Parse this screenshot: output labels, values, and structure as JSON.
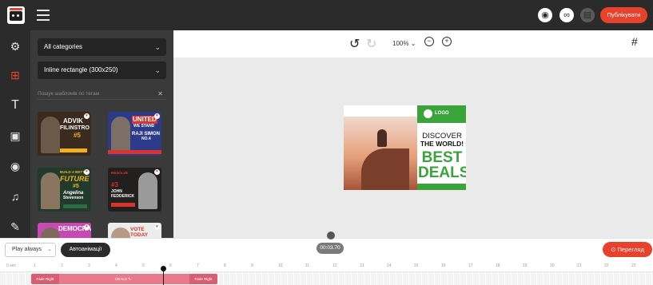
{
  "topbar": {
    "publish_label": "Публікувати"
  },
  "rail": {
    "items": [
      "settings-icon",
      "templates-icon",
      "text-icon",
      "image-icon",
      "video-icon",
      "music-icon",
      "brush-icon"
    ]
  },
  "panel": {
    "category_value": "All categories",
    "size_value": "Inline rectangle (300x250)",
    "search_placeholder": "Пошук шаблонів по тегам"
  },
  "templates": [
    {
      "line1": "ADVIK",
      "line2": "FILINSTRO",
      "line3": "#5"
    },
    {
      "line1": "UNITED",
      "line2": "WE STAND",
      "line3": "RAJI SIMON",
      "line4": "NO.4"
    },
    {
      "line1": "BUILD A BETTER",
      "line2": "FUTURE",
      "line3": "#5",
      "line4": "Angelina",
      "line5": "Stevenson"
    },
    {
      "line1": "RESOLVE",
      "line2": "#3",
      "line3": "JOHN",
      "line4": "FEDDERICK"
    },
    {
      "line1": "DEMOCRACY"
    },
    {
      "line1": "VOTE TODAY"
    }
  ],
  "toolbar": {
    "zoom_label": "100%"
  },
  "ad": {
    "logo_text": "LOGO",
    "discover": "DISCOVER",
    "the_world": "THE WORLD!",
    "best": "BEST",
    "deals": "DEALS"
  },
  "bottom": {
    "play_select_value": "Play always",
    "autoanim_label": "Автоанімації",
    "time_badge": "00:03.70",
    "preview_label": "Перегляд",
    "ruler_ticks": [
      "0 sec",
      "1",
      "2",
      "3",
      "4",
      "5",
      "6",
      "7",
      "8",
      "9",
      "10",
      "11",
      "12",
      "13",
      "14",
      "15",
      "16",
      "17",
      "18",
      "19",
      "20",
      "21",
      "22",
      "23"
    ],
    "clip_fade_in": "Fade Right",
    "clip_label": "DEALS",
    "clip_fade_out": "Fade Right"
  }
}
